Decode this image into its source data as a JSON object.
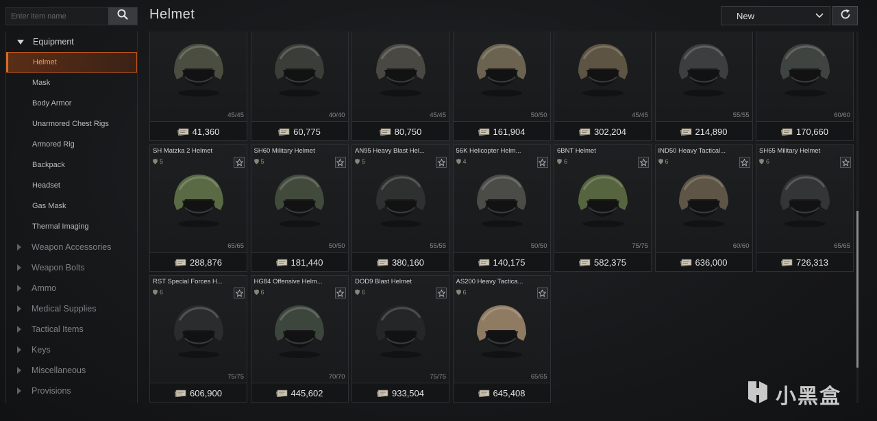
{
  "search": {
    "placeholder": "Enter item name"
  },
  "header": {
    "title": "Helmet",
    "sort_value": "New"
  },
  "sidebar": {
    "equipment": {
      "label": "Equipment",
      "items": [
        "Helmet",
        "Mask",
        "Body Armor",
        "Unarmored Chest Rigs",
        "Armored Rig",
        "Backpack",
        "Headset",
        "Gas Mask",
        "Thermal Imaging"
      ],
      "active": "Helmet"
    },
    "categories": [
      "Weapon Accessories",
      "Weapon Bolts",
      "Ammo",
      "Medical Supplies",
      "Tactical Items",
      "Keys",
      "Miscellaneous",
      "Provisions"
    ]
  },
  "items": [
    {
      "name": "",
      "level": "",
      "durability": "45/45",
      "price": "41,360",
      "color": "#4a4d40"
    },
    {
      "name": "",
      "level": "",
      "durability": "40/40",
      "price": "60,775",
      "color": "#3a3d38"
    },
    {
      "name": "",
      "level": "",
      "durability": "45/45",
      "price": "80,750",
      "color": "#4a4843"
    },
    {
      "name": "",
      "level": "",
      "durability": "50/50",
      "price": "161,904",
      "color": "#6b6250"
    },
    {
      "name": "",
      "level": "",
      "durability": "45/45",
      "price": "302,204",
      "color": "#5e5443"
    },
    {
      "name": "",
      "level": "",
      "durability": "55/55",
      "price": "214,890",
      "color": "#3d3e3f"
    },
    {
      "name": "",
      "level": "",
      "durability": "60/60",
      "price": "170,660",
      "color": "#3f4441"
    },
    {
      "name": "SH Matzka 2 Helmet",
      "level": "5",
      "durability": "65/65",
      "price": "288,876",
      "color": "#5a6a45"
    },
    {
      "name": "SH60 Military Helmet",
      "level": "5",
      "durability": "50/50",
      "price": "181,440",
      "color": "#424a3c"
    },
    {
      "name": "AN95 Heavy Blast Hel...",
      "level": "5",
      "durability": "55/55",
      "price": "380,160",
      "color": "#2f3131"
    },
    {
      "name": "56K Helicopter Helm...",
      "level": "4",
      "durability": "50/50",
      "price": "140,175",
      "color": "#4b4b48"
    },
    {
      "name": "6BNT Helmet",
      "level": "6",
      "durability": "75/75",
      "price": "582,375",
      "color": "#56643f"
    },
    {
      "name": "IND50 Heavy Tactical...",
      "level": "6",
      "durability": "60/60",
      "price": "636,000",
      "color": "#5f5546"
    },
    {
      "name": "SH65 Military Helmet",
      "level": "6",
      "durability": "65/65",
      "price": "726,313",
      "color": "#333537"
    },
    {
      "name": "RST Special Forces H...",
      "level": "6",
      "durability": "75/75",
      "price": "606,900",
      "color": "#2b2c2d"
    },
    {
      "name": "HG84 Offensive Helm...",
      "level": "6",
      "durability": "70/70",
      "price": "445,602",
      "color": "#3d463c"
    },
    {
      "name": "DOD9 Blast Helmet",
      "level": "6",
      "durability": "75/75",
      "price": "933,504",
      "color": "#252627"
    },
    {
      "name": "AS200 Heavy Tactica...",
      "level": "6",
      "durability": "65/65",
      "price": "645,408",
      "color": "#8f7a62"
    }
  ],
  "watermark": {
    "text": "小黑盒"
  }
}
